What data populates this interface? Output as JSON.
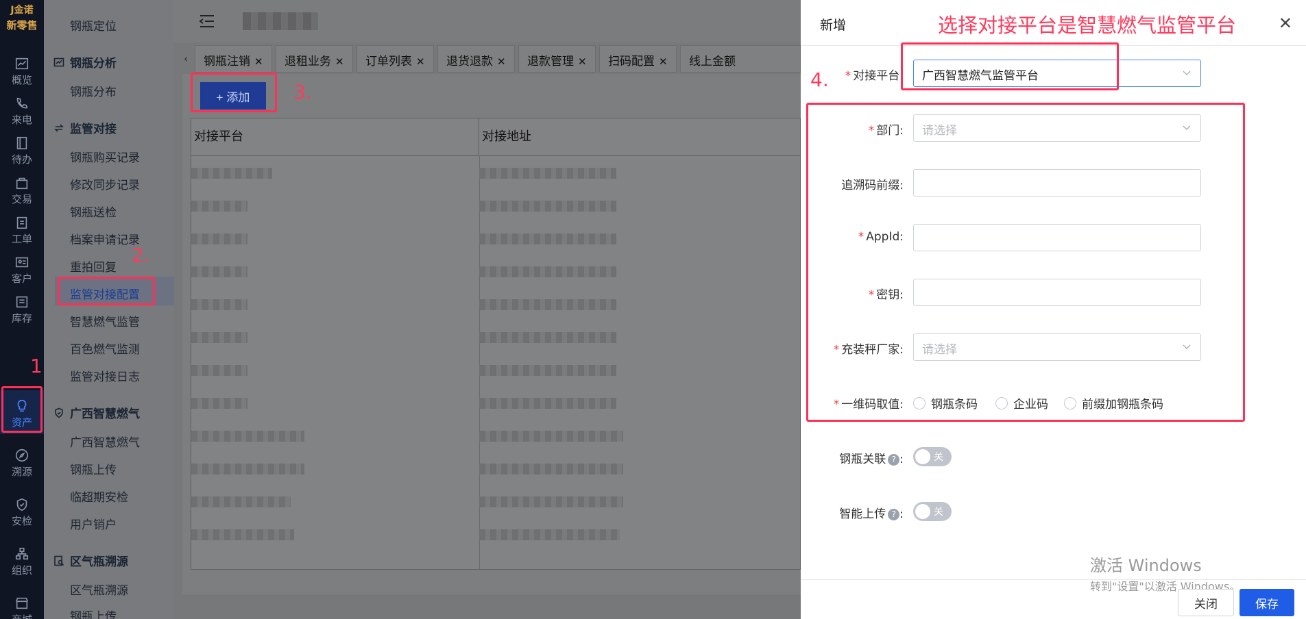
{
  "logo": {
    "line1": "J金诺",
    "line2": "新零售"
  },
  "rail": [
    {
      "label": "概览",
      "icon": "chart-icon"
    },
    {
      "label": "来电",
      "icon": "phone-icon"
    },
    {
      "label": "待办",
      "icon": "book-icon"
    },
    {
      "label": "交易",
      "icon": "bag-icon"
    },
    {
      "label": "工单",
      "icon": "clipboard-icon"
    },
    {
      "label": "客户",
      "icon": "id-card-icon"
    },
    {
      "label": "库存",
      "icon": "list-icon"
    },
    {
      "label": "资产",
      "icon": "bulb-icon",
      "active": true
    },
    {
      "label": "溯源",
      "icon": "compass-icon"
    },
    {
      "label": "安检",
      "icon": "shield-icon"
    },
    {
      "label": "组织",
      "icon": "org-icon"
    },
    {
      "label": "商城",
      "icon": "shop-icon"
    }
  ],
  "submenu": {
    "top_item": "钢瓶定位",
    "groups": [
      {
        "title": "钢瓶分析",
        "icon": "chart-icon",
        "items": [
          "钢瓶分布"
        ]
      },
      {
        "title": "监管对接",
        "icon": "swap-icon",
        "items": [
          "钢瓶购买记录",
          "修改同步记录",
          "钢瓶送检",
          "档案申请记录",
          "重拍回复",
          "监管对接配置",
          "智慧燃气监管",
          "百色燃气监测",
          "监管对接日志"
        ]
      },
      {
        "title": "广西智慧燃气",
        "icon": "shield-icon",
        "items": [
          "广西智慧燃气",
          "钢瓶上传",
          "临超期安检",
          "用户销户"
        ]
      },
      {
        "title": "区气瓶溯源",
        "icon": "search-doc-icon",
        "items": [
          "区气瓶溯源",
          "钢瓶上传"
        ]
      }
    ],
    "active_item": "监管对接配置"
  },
  "tabs": [
    {
      "label": "钢瓶注销"
    },
    {
      "label": "退租业务"
    },
    {
      "label": "订单列表"
    },
    {
      "label": "退货退款"
    },
    {
      "label": "退款管理"
    },
    {
      "label": "扫码配置"
    },
    {
      "label": "线上金额"
    }
  ],
  "content": {
    "add_label": "+ 添加",
    "columns": [
      "对接平台",
      "对接地址"
    ]
  },
  "drawer": {
    "title": "新增",
    "annotation": "选择对接平台是智慧燃气监管平台",
    "fields": {
      "platform": {
        "label": "对接平台",
        "value": "广西智慧燃气监管平台"
      },
      "dept": {
        "label": "部门",
        "placeholder": "请选择"
      },
      "trace_prefix": {
        "label": "追溯码前缀",
        "value": ""
      },
      "appid": {
        "label": "AppId",
        "value": ""
      },
      "secret": {
        "label": "密钥",
        "value": ""
      },
      "filler": {
        "label": "充装秤厂家",
        "placeholder": "请选择"
      },
      "barcode": {
        "label": "一维码取值",
        "options": [
          "钢瓶条码",
          "企业码",
          "前缀加钢瓶条码"
        ]
      },
      "cyl_link": {
        "label": "钢瓶关联",
        "state": "关"
      },
      "smart_upload": {
        "label": "智能上传",
        "state": "关"
      }
    },
    "close_label": "关闭",
    "save_label": "保存"
  },
  "watermark": {
    "line1": "激活 Windows",
    "line2": "转到\"设置\"以激活 Windows。"
  },
  "annotations": {
    "n1": "1",
    "n2": "2.",
    "n3": "3.",
    "n4": "4."
  }
}
